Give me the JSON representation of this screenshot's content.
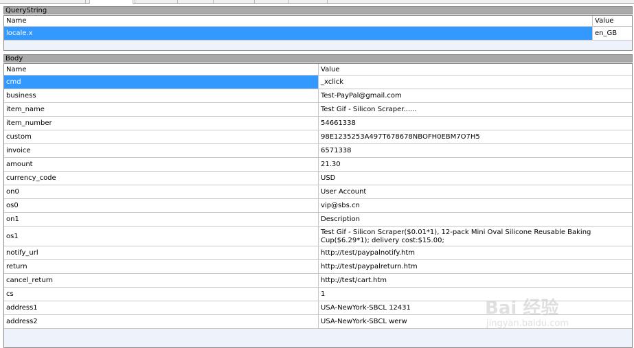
{
  "querystring": {
    "title": "QueryString",
    "columns": {
      "name": "Name",
      "value": "Value"
    },
    "rows": [
      {
        "name": "locale.x",
        "value": "en_GB",
        "selected": true
      }
    ]
  },
  "body": {
    "title": "Body",
    "columns": {
      "name": "Name",
      "value": "Value"
    },
    "rows": [
      {
        "name": "cmd",
        "value": "_xclick",
        "selected": true
      },
      {
        "name": "business",
        "value": "Test-PayPal@gmail.com"
      },
      {
        "name": "item_name",
        "value": "Test Gif - Silicon Scraper......"
      },
      {
        "name": "item_number",
        "value": "54661338"
      },
      {
        "name": "custom",
        "value": "98E1235253A497T678678NBOFH0EBM7O7H5"
      },
      {
        "name": "invoice",
        "value": "6571338"
      },
      {
        "name": "amount",
        "value": "21.30"
      },
      {
        "name": "currency_code",
        "value": "USD"
      },
      {
        "name": "on0",
        "value": "User Account"
      },
      {
        "name": "os0",
        "value": "vip@sbs.cn"
      },
      {
        "name": "on1",
        "value": "Description"
      },
      {
        "name": "os1",
        "value": "Test Gif - Silicon Scraper($0.01*1), 12-pack Mini Oval Silicone Reusable Baking Cup($6.29*1); delivery cost:$15.00;"
      },
      {
        "name": "notify_url",
        "value": "http://test/paypalnotify.htm"
      },
      {
        "name": "return",
        "value": "http://test/paypalreturn.htm"
      },
      {
        "name": "cancel_return",
        "value": "http://test/cart.htm"
      },
      {
        "name": "cs",
        "value": "1"
      },
      {
        "name": "address1",
        "value": "USA-NewYork-SBCL 12431"
      },
      {
        "name": "address2",
        "value": "USA-NewYork-SBCL werw"
      }
    ]
  },
  "watermark": {
    "brand": "Bai 经验",
    "sub": "jingyan.baidu.com"
  }
}
